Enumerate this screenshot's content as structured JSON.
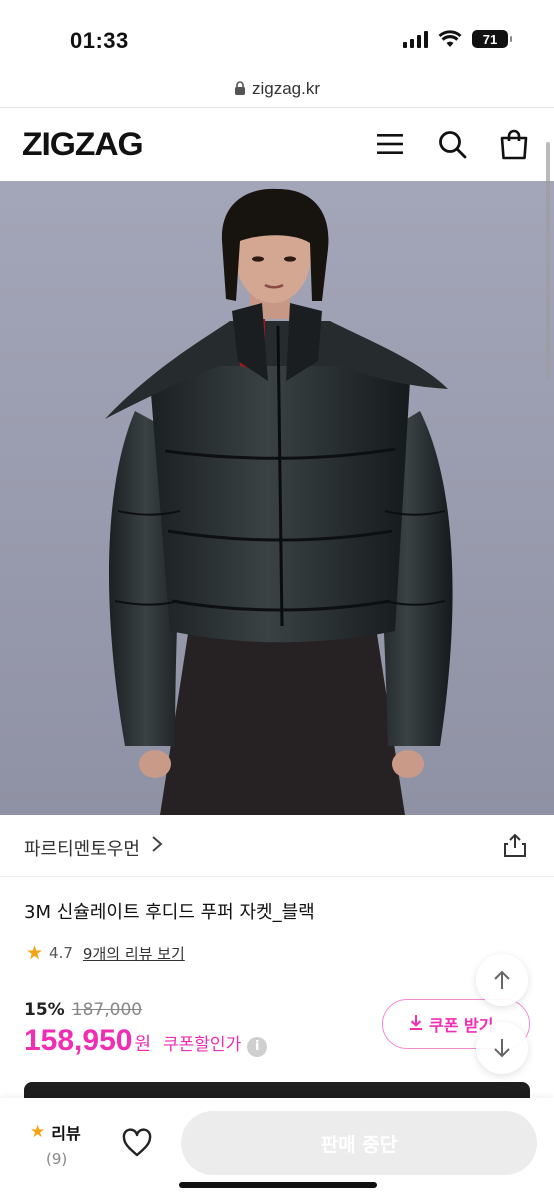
{
  "status": {
    "time": "01:33",
    "battery": "71"
  },
  "browser": {
    "url": "zigzag.kr"
  },
  "header": {
    "logo": "ZIGZAG",
    "menu_icon": "menu-icon",
    "search_icon": "search-icon",
    "bag_icon": "shopping-bag-icon"
  },
  "product": {
    "seller": "파르티멘토우먼",
    "title": "3M 신슐레이트 후디드 푸퍼 자켓_블랙",
    "rating": "4.7",
    "review_link": "9개의 리뷰 보기",
    "discount": "15%",
    "original_price": "187,000",
    "price": "158,950",
    "currency": "원",
    "coupon_price_label": "쿠폰할인가",
    "coupon_button": "쿠폰 받기"
  },
  "bottom": {
    "review_label": "리뷰",
    "review_count": "(9)",
    "stop_button": "판매 중단"
  },
  "colors": {
    "accent": "#f12db3",
    "star": "#f2a413"
  }
}
